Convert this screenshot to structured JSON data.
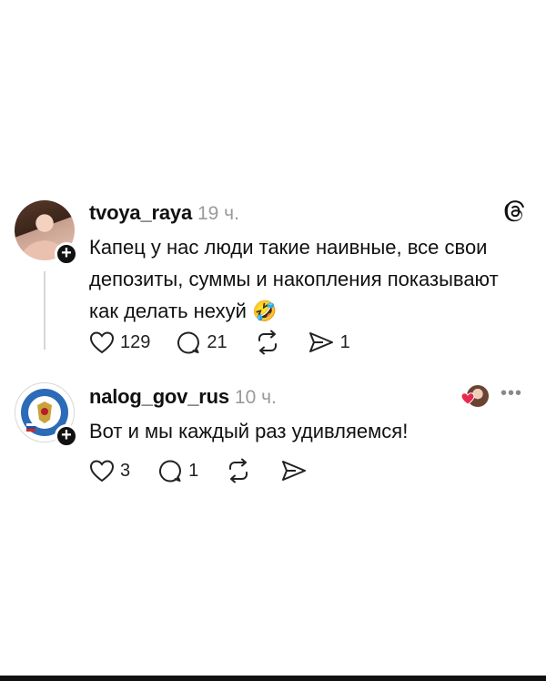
{
  "posts": [
    {
      "username": "tvoya_raya",
      "time": "19 ч.",
      "text": "Капец у нас люди такие наивные, все свои депозиты, суммы и накопления показывают как делать нехуй 🤣",
      "likes": "129",
      "comments": "21",
      "shares": "1",
      "avatar": "user-avatar-photo"
    },
    {
      "username": "nalog_gov_rus",
      "time": "10 ч.",
      "text": "Вот и мы каждый раз удивляемся!",
      "likes": "3",
      "comments": "1",
      "avatar": "tax-service-emblem"
    }
  ],
  "icons": {
    "threads_logo": "threads-logo-icon",
    "like": "heart-icon",
    "comment": "comment-bubble-icon",
    "repost": "repost-icon",
    "share": "send-icon",
    "more": "more-options-icon"
  },
  "colors": {
    "background": "#ffffff",
    "text": "#111111",
    "muted": "#9a9a9a",
    "liked_heart": "#e8294f"
  }
}
